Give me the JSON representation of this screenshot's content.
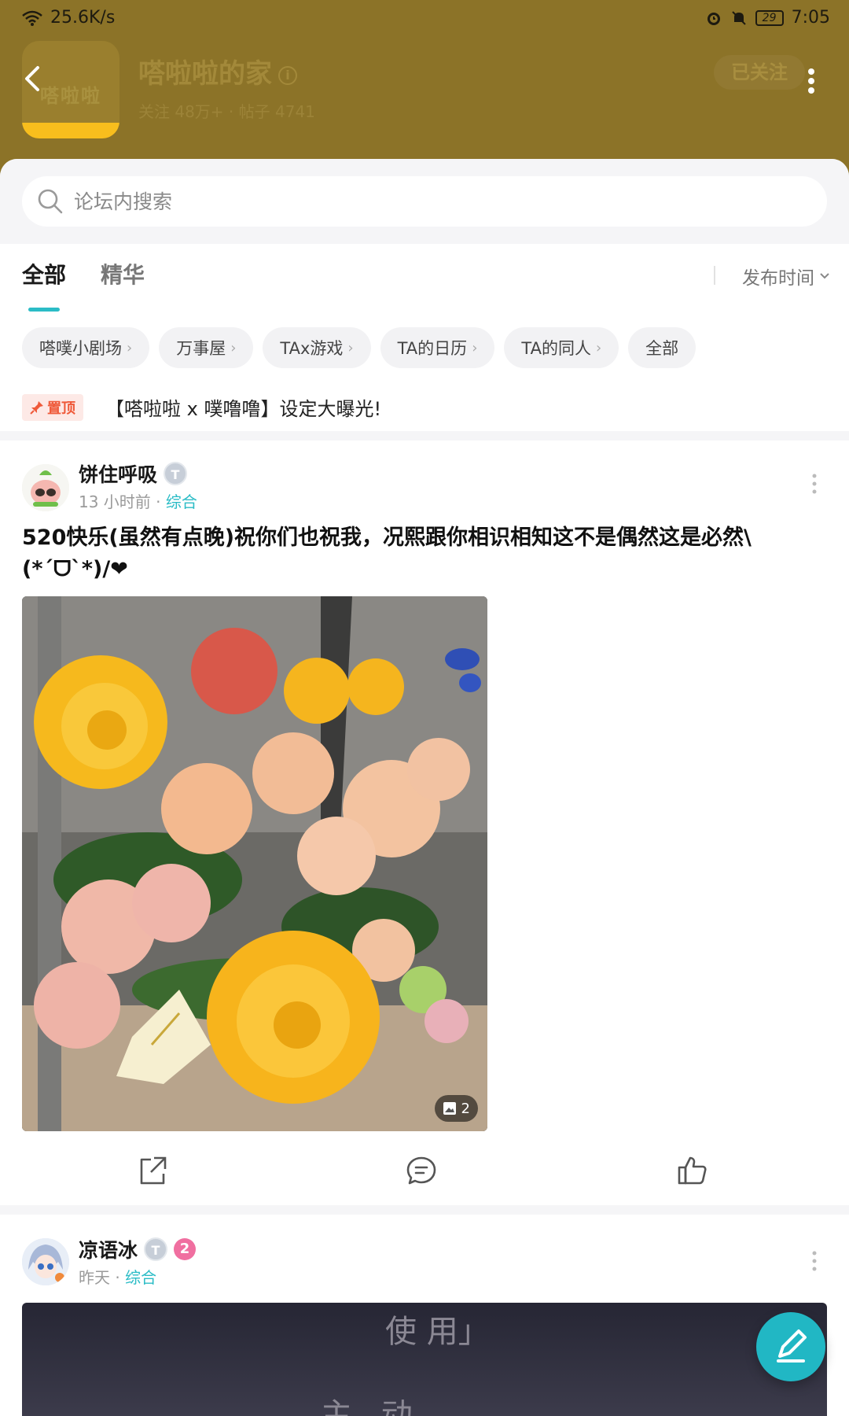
{
  "status_bar": {
    "speed": "25.6K/s",
    "battery": "29",
    "time": "7:05"
  },
  "forum": {
    "logo_text": "嗒啦啦",
    "name": "嗒啦啦的家",
    "stats": "关注 48万+ · 帖子 4741",
    "follow_label": "已关注"
  },
  "search": {
    "placeholder": "论坛内搜索"
  },
  "tabs": [
    {
      "label": "全部",
      "active": true
    },
    {
      "label": "精华",
      "active": false
    }
  ],
  "sort": {
    "label": "发布时间"
  },
  "chips": [
    {
      "label": "嗒噗小剧场"
    },
    {
      "label": "万事屋"
    },
    {
      "label": "TAx游戏"
    },
    {
      "label": "TA的日历"
    },
    {
      "label": "TA的同人"
    },
    {
      "label": "全部"
    }
  ],
  "pinned": {
    "badge": "置顶",
    "title": "【嗒啦啦 x 噗噜噜】设定大曝光!"
  },
  "posts": [
    {
      "username": "饼住呼吸",
      "level": "T",
      "time": "13 小时前",
      "category": "综合",
      "title": "520快乐(虽然有点晚)祝你们也祝我，况熙跟你相识相知这不是偶然这是必然\\(*ˊᗜˋ*)/❤",
      "image_count": "2"
    },
    {
      "username": "凉语冰",
      "level": "T",
      "badge_num": "2",
      "time": "昨天",
      "category": "综合",
      "image_text_top": "使 用」",
      "image_text_bottom": "主 动"
    }
  ],
  "colors": {
    "header": "#8c7328",
    "accent": "#2bbcc6",
    "pin": "#ef5a3a"
  }
}
